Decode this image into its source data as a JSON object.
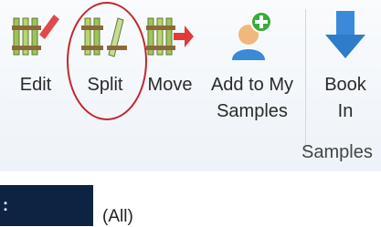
{
  "ribbon": {
    "buttons": [
      {
        "id": "edit",
        "label": "Edit",
        "icon": "tube-rack-edit-icon"
      },
      {
        "id": "split",
        "label": "Split",
        "icon": "tube-rack-split-icon",
        "highlighted": true
      },
      {
        "id": "move",
        "label": "Move",
        "icon": "tube-rack-move-icon"
      },
      {
        "id": "add",
        "label": "Add to My",
        "label2": "Samples",
        "icon": "add-user-icon"
      },
      {
        "id": "book",
        "label": "Book",
        "label2": "In",
        "icon": "download-arrow-icon"
      }
    ],
    "group_label": "Samples"
  },
  "filter": {
    "left_text": ":",
    "value": "(All)"
  },
  "colors": {
    "highlight": "#c0282d",
    "accent_blue": "#3b8ad9",
    "dark_bar": "#0c2442"
  }
}
